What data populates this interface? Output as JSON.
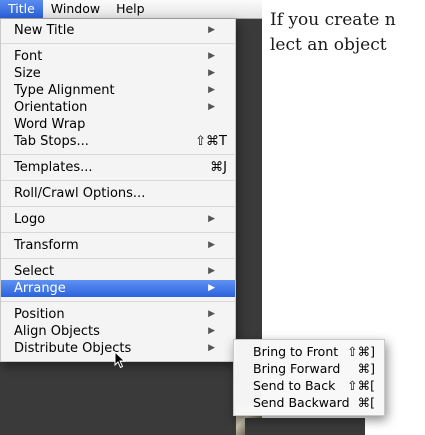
{
  "menubar": {
    "items": [
      "Title",
      "Window",
      "Help"
    ]
  },
  "body_text": {
    "line1": "If you create n",
    "line2": "lect an object"
  },
  "title_menu": {
    "new_title": "New Title",
    "font": "Font",
    "size": "Size",
    "type_alignment": "Type Alignment",
    "orientation": "Orientation",
    "word_wrap": "Word Wrap",
    "tab_stops": "Tab Stops...",
    "tab_stops_shortcut": "⇧⌘T",
    "templates": "Templates...",
    "templates_shortcut": "⌘J",
    "roll_crawl": "Roll/Crawl Options...",
    "logo": "Logo",
    "transform": "Transform",
    "select": "Select",
    "arrange": "Arrange",
    "position": "Position",
    "align_objects": "Align Objects",
    "distribute_objects": "Distribute Objects"
  },
  "arrange_submenu": {
    "items": [
      {
        "label": "Bring to Front",
        "shortcut": "⇧⌘]"
      },
      {
        "label": "Bring Forward",
        "shortcut": "⌘]"
      },
      {
        "label": "Send to Back",
        "shortcut": "⇧⌘["
      },
      {
        "label": "Send Backward",
        "shortcut": "⌘["
      }
    ]
  },
  "colors": {
    "highlight": "#2b62dc",
    "menu_bg": "#f8f8f8"
  },
  "icons": [
    "submenu-arrow-icon",
    "mouse-pointer-icon"
  ]
}
